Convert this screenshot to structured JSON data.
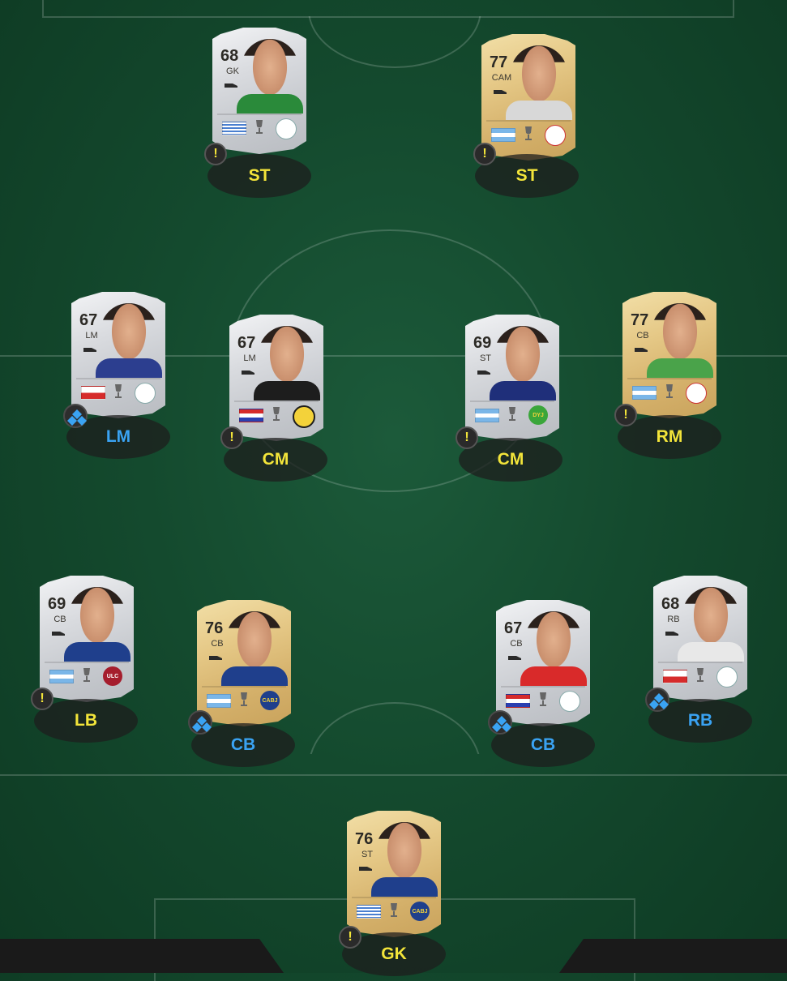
{
  "colors": {
    "alert": "#f3e53a",
    "chem": "#3aa3f3",
    "pitch": "#144a2e"
  },
  "players": [
    {
      "id": "p1",
      "rating": "68",
      "pos": "GK",
      "tier": "silver",
      "slot": "ST",
      "slot_color": "yellow",
      "badge": "alert",
      "flag": "uruguay",
      "club": "club-icon",
      "kit": "#2a8a3a"
    },
    {
      "id": "p2",
      "rating": "77",
      "pos": "CAM",
      "tier": "gold",
      "slot": "ST",
      "slot_color": "yellow",
      "badge": "alert",
      "flag": "argentina",
      "club": "river-plate-icon",
      "kit": "#d8d8d8"
    },
    {
      "id": "p3",
      "rating": "67",
      "pos": "LM",
      "tier": "silver",
      "slot": "LM",
      "slot_color": "blue",
      "badge": "chem",
      "flag": "chile",
      "club": "club-icon",
      "kit": "#2c3e8f"
    },
    {
      "id": "p4",
      "rating": "67",
      "pos": "LM",
      "tier": "silver",
      "slot": "CM",
      "slot_color": "yellow",
      "badge": "alert",
      "flag": "paraguay",
      "club": "guarani-icon",
      "kit": "#1d1d1d"
    },
    {
      "id": "p5",
      "rating": "69",
      "pos": "ST",
      "tier": "silver",
      "slot": "CM",
      "slot_color": "yellow",
      "badge": "alert",
      "flag": "argentina",
      "club": "defensa-icon",
      "kit": "#1f2f7a"
    },
    {
      "id": "p6",
      "rating": "77",
      "pos": "CB",
      "tier": "gold",
      "slot": "RM",
      "slot_color": "yellow",
      "badge": "alert",
      "flag": "argentina",
      "club": "river-plate-icon",
      "kit": "#4aa34a"
    },
    {
      "id": "p7",
      "rating": "69",
      "pos": "CB",
      "tier": "silver",
      "slot": "LB",
      "slot_color": "yellow",
      "badge": "alert",
      "flag": "argentina",
      "club": "ulc-icon",
      "kit": "#1f3f8c"
    },
    {
      "id": "p8",
      "rating": "76",
      "pos": "CB",
      "tier": "gold",
      "slot": "CB",
      "slot_color": "blue",
      "badge": "chem",
      "flag": "argentina",
      "club": "boca-icon",
      "kit": "#1f3f8c"
    },
    {
      "id": "p9",
      "rating": "67",
      "pos": "CB",
      "tier": "silver",
      "slot": "CB",
      "slot_color": "blue",
      "badge": "chem",
      "flag": "paraguay",
      "club": "club-icon",
      "kit": "#d92a2a"
    },
    {
      "id": "p10",
      "rating": "68",
      "pos": "RB",
      "tier": "silver",
      "slot": "RB",
      "slot_color": "blue",
      "badge": "chem",
      "flag": "chile",
      "club": "club-icon",
      "kit": "#e8e8e8"
    },
    {
      "id": "p11",
      "rating": "76",
      "pos": "ST",
      "tier": "gold",
      "slot": "GK",
      "slot_color": "yellow",
      "badge": "alert",
      "flag": "uruguay",
      "club": "boca-icon",
      "kit": "#1f3f8c"
    }
  ],
  "club_text": {
    "ulc": "ULC",
    "boca": "CABJ",
    "defensa": "DYJ"
  },
  "alert_glyph": "!"
}
